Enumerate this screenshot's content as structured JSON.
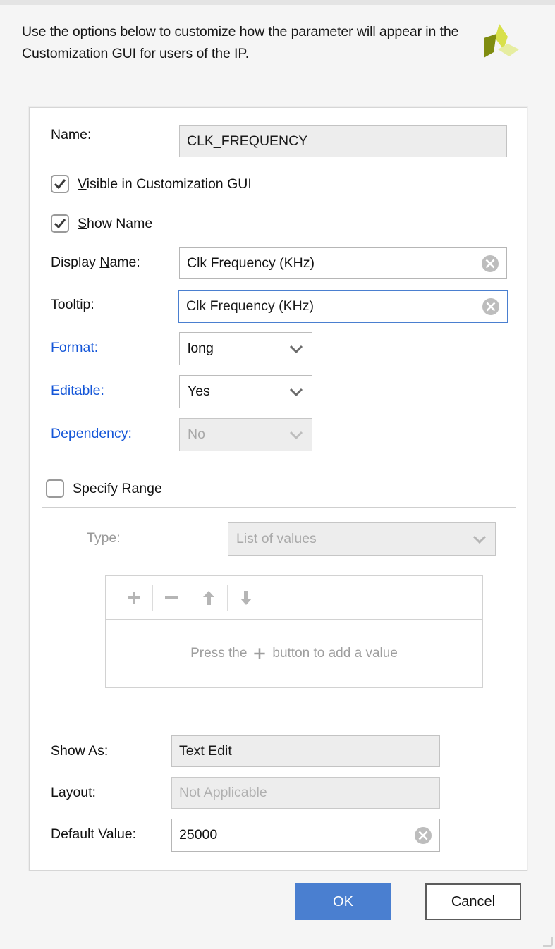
{
  "header": {
    "description": "Use the options below to customize how the parameter will appear in the Customization GUI for users of the IP.",
    "logo_name": "vivado-pinwheel-logo"
  },
  "form": {
    "name": {
      "label": "Name:",
      "value": "CLK_FREQUENCY"
    },
    "visible_checkbox": {
      "label_pre": "",
      "mnemonic": "V",
      "label_post": "isible in Customization GUI",
      "checked": true
    },
    "show_name_checkbox": {
      "mnemonic": "S",
      "label_post": "how Name",
      "checked": true
    },
    "display_name": {
      "label_pre": "Display ",
      "mnemonic": "N",
      "label_post": "ame:",
      "value": "Clk Frequency (KHz)",
      "clear_icon": "clear-circle-icon"
    },
    "tooltip": {
      "label": "Tooltip:",
      "value": "Clk Frequency (KHz)",
      "focused": true,
      "clear_icon": "clear-circle-icon"
    },
    "format": {
      "mnemonic": "F",
      "label_post": "ormat:",
      "value": "long",
      "enabled": true
    },
    "editable": {
      "mnemonic": "E",
      "label_post": "ditable:",
      "value": "Yes",
      "enabled": true
    },
    "dependency": {
      "label_pre": "De",
      "mnemonic": "p",
      "label_post": "endency:",
      "value": "No",
      "enabled": false
    },
    "specify_range": {
      "label_pre": "Spe",
      "mnemonic": "c",
      "label_post": "ify Range",
      "checked": false
    },
    "type": {
      "label": "Type:",
      "value": "List of values",
      "enabled": false
    },
    "values_list": {
      "toolbar": [
        {
          "name": "add-value-button",
          "glyph": "plus"
        },
        {
          "name": "remove-value-button",
          "glyph": "minus"
        },
        {
          "name": "move-up-button",
          "glyph": "arrow-up"
        },
        {
          "name": "move-down-button",
          "glyph": "arrow-down"
        }
      ],
      "empty_text_before": "Press the",
      "empty_text_after": "button to add a value"
    },
    "show_as": {
      "label": "Show As:",
      "value": "Text Edit"
    },
    "layout": {
      "label": "Layout:",
      "value": "Not Applicable"
    },
    "default_value": {
      "label": "Default Value:",
      "value": "25000",
      "clear_icon": "clear-circle-icon"
    }
  },
  "footer": {
    "ok_label": "OK",
    "cancel_label": "Cancel"
  },
  "colors": {
    "accent_blue": "#4a7fd0",
    "link_blue": "#1456d8",
    "logo_olive": "#7f8c10",
    "logo_yellow": "#d8e04a",
    "logo_pale": "#e6eda0"
  }
}
